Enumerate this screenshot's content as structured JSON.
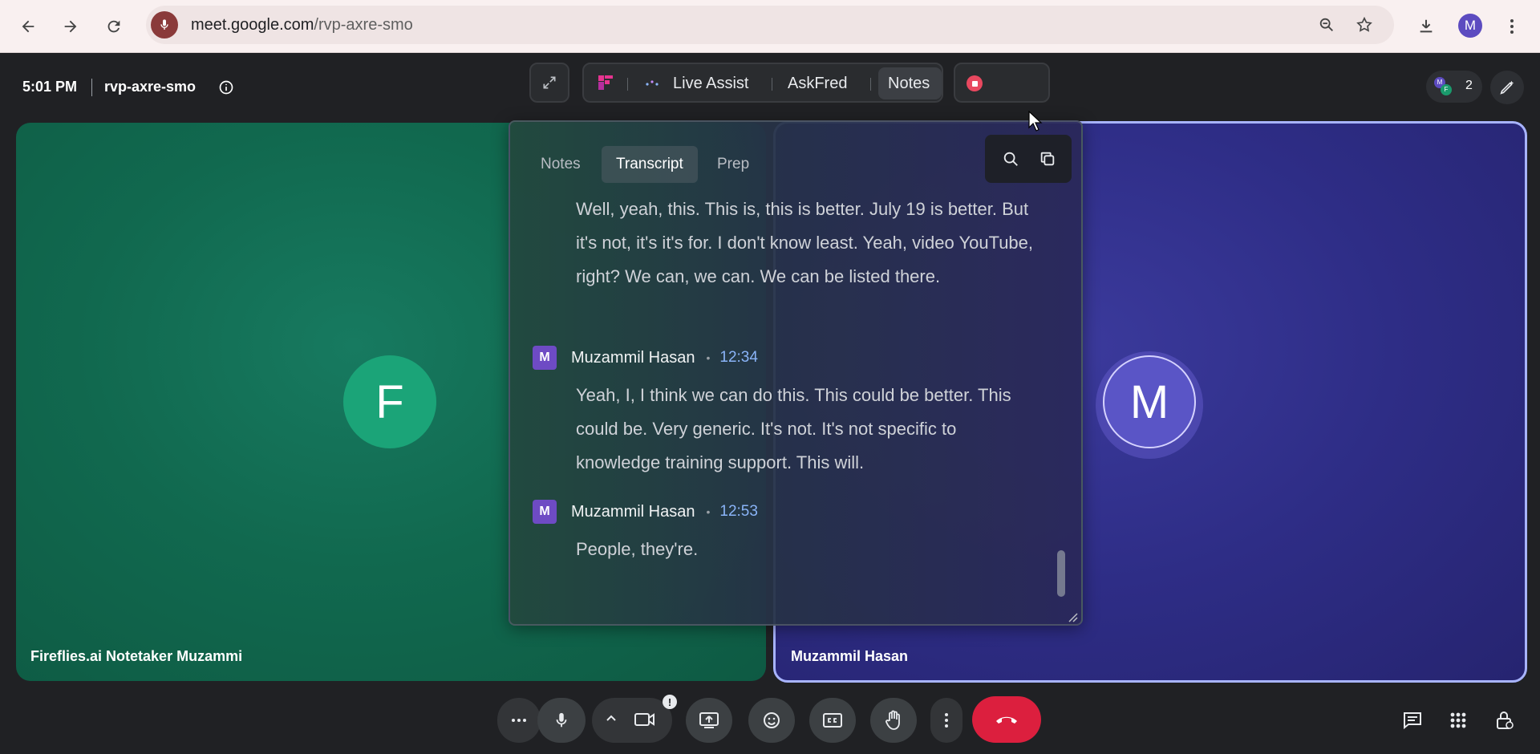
{
  "browser": {
    "url_host": "meet.google.com",
    "url_path": "/rvp-axre-smo",
    "profile_initial": "M"
  },
  "meet": {
    "time": "5:01 PM",
    "meeting_code": "rvp-axre-smo",
    "participant_count": "2"
  },
  "fireflies_bar": {
    "live_assist": "Live Assist",
    "askfred": "AskFred",
    "notes": "Notes"
  },
  "panel": {
    "tabs": [
      "Notes",
      "Transcript",
      "Prep"
    ],
    "active_tab": "Transcript",
    "segments": [
      {
        "speaker": "",
        "time": "",
        "text": "Well, yeah, this. This is, this is better. July 19 is better. But it's not, it's it's for. I don't know least. Yeah, video YouTube, right? We can, we can. We can be listed there."
      },
      {
        "speaker": "Muzammil Hasan",
        "initial": "M",
        "time": "12:34",
        "text": "Yeah, I, I think we can do this. This could be better. This could be. Very generic. It's not. It's not specific to knowledge training support. This will."
      },
      {
        "speaker": "Muzammil Hasan",
        "initial": "M",
        "time": "12:53",
        "text": "People, they're."
      }
    ]
  },
  "tiles": {
    "left": {
      "initial": "F",
      "name": "Fireflies.ai Notetaker Muzammi",
      "color": "#1ba478"
    },
    "right": {
      "initial": "M",
      "name": "Muzammil Hasan",
      "color": "#5a55c6"
    }
  },
  "colors": {
    "hangup": "#dc1f3e",
    "record": "#e8485f",
    "timestamp": "#8ab4f8"
  }
}
